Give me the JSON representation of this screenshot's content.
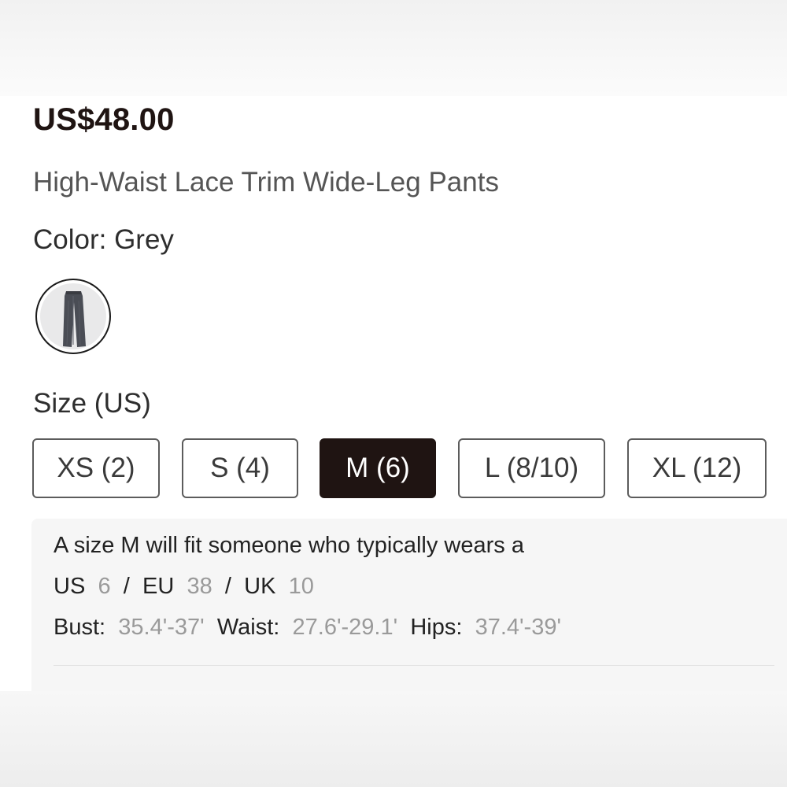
{
  "product": {
    "price": "US$48.00",
    "name": "High-Waist Lace Trim Wide-Leg Pants",
    "color_label": "Color: Grey",
    "swatch_icon": "pants-thumbnail"
  },
  "size_section": {
    "label": "Size (US)",
    "options": [
      {
        "label": "XS (2)",
        "selected": false
      },
      {
        "label": "S (4)",
        "selected": false
      },
      {
        "label": "M (6)",
        "selected": true
      },
      {
        "label": "L (8/10)",
        "selected": false
      },
      {
        "label": "XL (12)",
        "selected": false
      }
    ]
  },
  "fit_info": {
    "line1": "A size M will fit someone who typically wears a",
    "us_label": "US",
    "us_value": "6",
    "eu_label": "EU",
    "eu_value": "38",
    "uk_label": "UK",
    "uk_value": "10",
    "sep": "/",
    "bust_label": "Bust:",
    "bust_value": "35.4'-37'",
    "waist_label": "Waist:",
    "waist_value": "27.6'-29.1'",
    "hips_label": "Hips:",
    "hips_value": "37.4'-39'"
  },
  "colors": {
    "price": "#1f1412",
    "selected_size_bg": "#1f1412",
    "muted_value": "#9a9a9a",
    "fit_box_bg": "#f6f6f6"
  }
}
